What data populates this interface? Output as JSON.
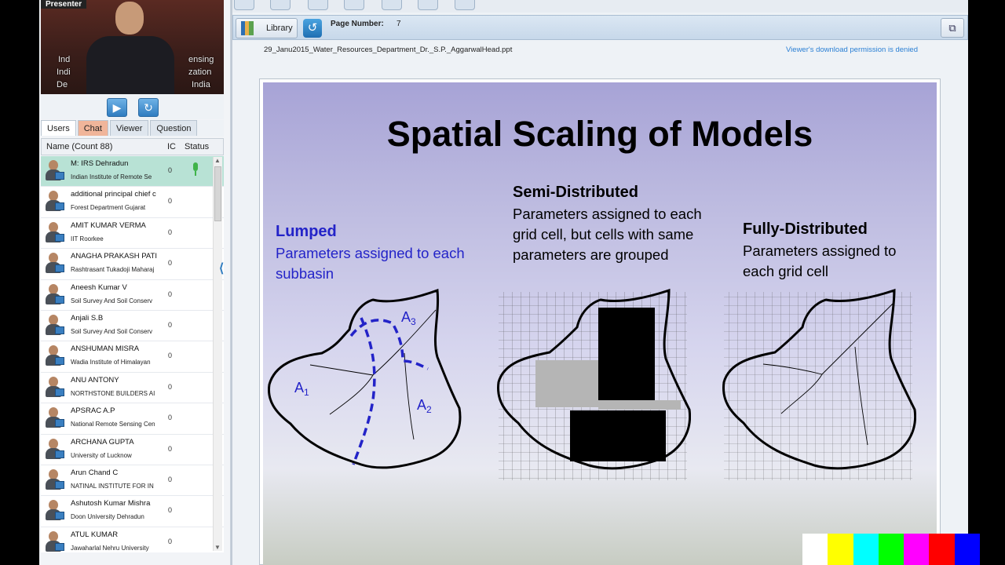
{
  "presenter_panel": {
    "presenter_tag": "Presenter",
    "video_overlay": [
      "Ind",
      "Indi",
      "De",
      "ensing",
      "zation",
      "India"
    ],
    "play_icon": "play-icon",
    "refresh_icon": "refresh-icon"
  },
  "tabs": [
    {
      "label": "Users",
      "active": true
    },
    {
      "label": "Chat",
      "highlight": true
    },
    {
      "label": "Viewer"
    },
    {
      "label": "Question"
    }
  ],
  "user_list": {
    "col_name": "Name (Count 88)",
    "col_ic": "IC",
    "col_status": "Status",
    "users": [
      {
        "name": "M: IRS Dehradun",
        "org": "Indian Institute of Remote Se",
        "ic": "0",
        "selected": true,
        "mic": true
      },
      {
        "name": "additional principal chief c",
        "org": "Forest Department Gujarat",
        "ic": "0"
      },
      {
        "name": "AMIT KUMAR VERMA",
        "org": "IIT Roorkee",
        "ic": "0"
      },
      {
        "name": "ANAGHA PRAKASH PATI",
        "org": "Rashtrasant Tukadoji Maharaj",
        "ic": "0"
      },
      {
        "name": "Aneesh Kumar V",
        "org": "Soil Survey And Soil Conserv",
        "ic": "0"
      },
      {
        "name": "Anjali S.B",
        "org": "Soil Survey And Soil Conserv",
        "ic": "0"
      },
      {
        "name": "ANSHUMAN MISRA",
        "org": "Wadia Institute of Himalayan",
        "ic": "0"
      },
      {
        "name": "ANU ANTONY",
        "org": "NORTHSTONE BUILDERS AI",
        "ic": "0"
      },
      {
        "name": "APSRAC A.P",
        "org": "National Remote Sensing Cen",
        "ic": "0"
      },
      {
        "name": "ARCHANA GUPTA",
        "org": "University of Lucknow",
        "ic": "0"
      },
      {
        "name": "Arun Chand C",
        "org": "NATINAL INSTITUTE FOR IN",
        "ic": "0"
      },
      {
        "name": "Ashutosh Kumar Mishra",
        "org": "Doon University Dehradun",
        "ic": "0"
      },
      {
        "name": "ATUL KUMAR",
        "org": "Jawaharlal Nehru University",
        "ic": "0"
      }
    ]
  },
  "toolbar": {
    "library_label": "Library",
    "page_number_label": "Page Number:",
    "page_number_value": "7",
    "popout_icon": "popout-icon"
  },
  "document": {
    "filename": "29_Janu2015_Water_Resources_Department_Dr._S.P._AggarwalHead.ppt",
    "permission_note": "Viewer's download permission is denied"
  },
  "slide": {
    "title": "Spatial Scaling of Models",
    "lumped_heading": "Lumped",
    "lumped_body": "Parameters assigned to each subbasin",
    "semi_heading": "Semi-Distributed",
    "semi_body": "Parameters assigned to each grid cell, but cells with same parameters are grouped",
    "full_heading": "Fully-Distributed",
    "full_body": "Parameters assigned to each grid cell",
    "subbasin_labels": [
      "A1",
      "A2",
      "A3"
    ]
  },
  "colors": {
    "lumped_blue": "#2323c8",
    "mic_green": "#3fb34a",
    "selected_row": "#b8e2d5",
    "chat_tab": "#f0b59a",
    "link_blue": "#2a7fd4"
  },
  "test_bars": [
    "#ffffff",
    "#ffff00",
    "#00ffff",
    "#00ff00",
    "#ff00ff",
    "#ff0000",
    "#0000ff",
    "#000000"
  ]
}
